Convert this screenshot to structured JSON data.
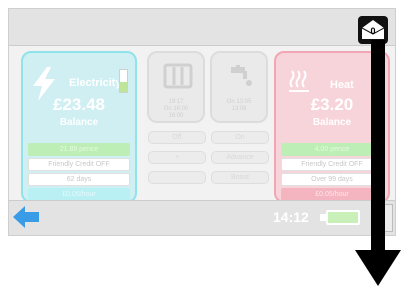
{
  "messages": {
    "count": "0",
    "icon": "envelope-icon"
  },
  "electricity": {
    "label": "Electricity",
    "balance": "£23.48",
    "sub": "Balance",
    "meter_fraction": 0.45,
    "rows": [
      "21.89 pence",
      "Friendly Credit OFF",
      "62 days",
      "£0.05/hour"
    ],
    "icon": "lightning-icon"
  },
  "heat": {
    "label": "Heat",
    "balance": "£3.20",
    "sub": "Balance",
    "rows": [
      "4.00 pence",
      "Friendly Credit OFF",
      "Over 99 days",
      "£0.05/hour"
    ],
    "icon": "heat-waves-icon"
  },
  "mid_cards": [
    {
      "icon": "radiator-icon",
      "text": [
        "19:17",
        "On 16:00",
        "16:00"
      ]
    },
    {
      "icon": "hot-tap-icon",
      "text": [
        "On 13:05",
        "13:06"
      ]
    }
  ],
  "mid_buttons": [
    [
      "Off",
      "+",
      ""
    ],
    [
      "On",
      "Advance",
      "Boost"
    ]
  ],
  "statusbar": {
    "time": "14:12"
  },
  "colors": {
    "electricity": "#8fe3ea",
    "heat": "#f2a6b4",
    "accent_blue": "#3a9be6"
  }
}
